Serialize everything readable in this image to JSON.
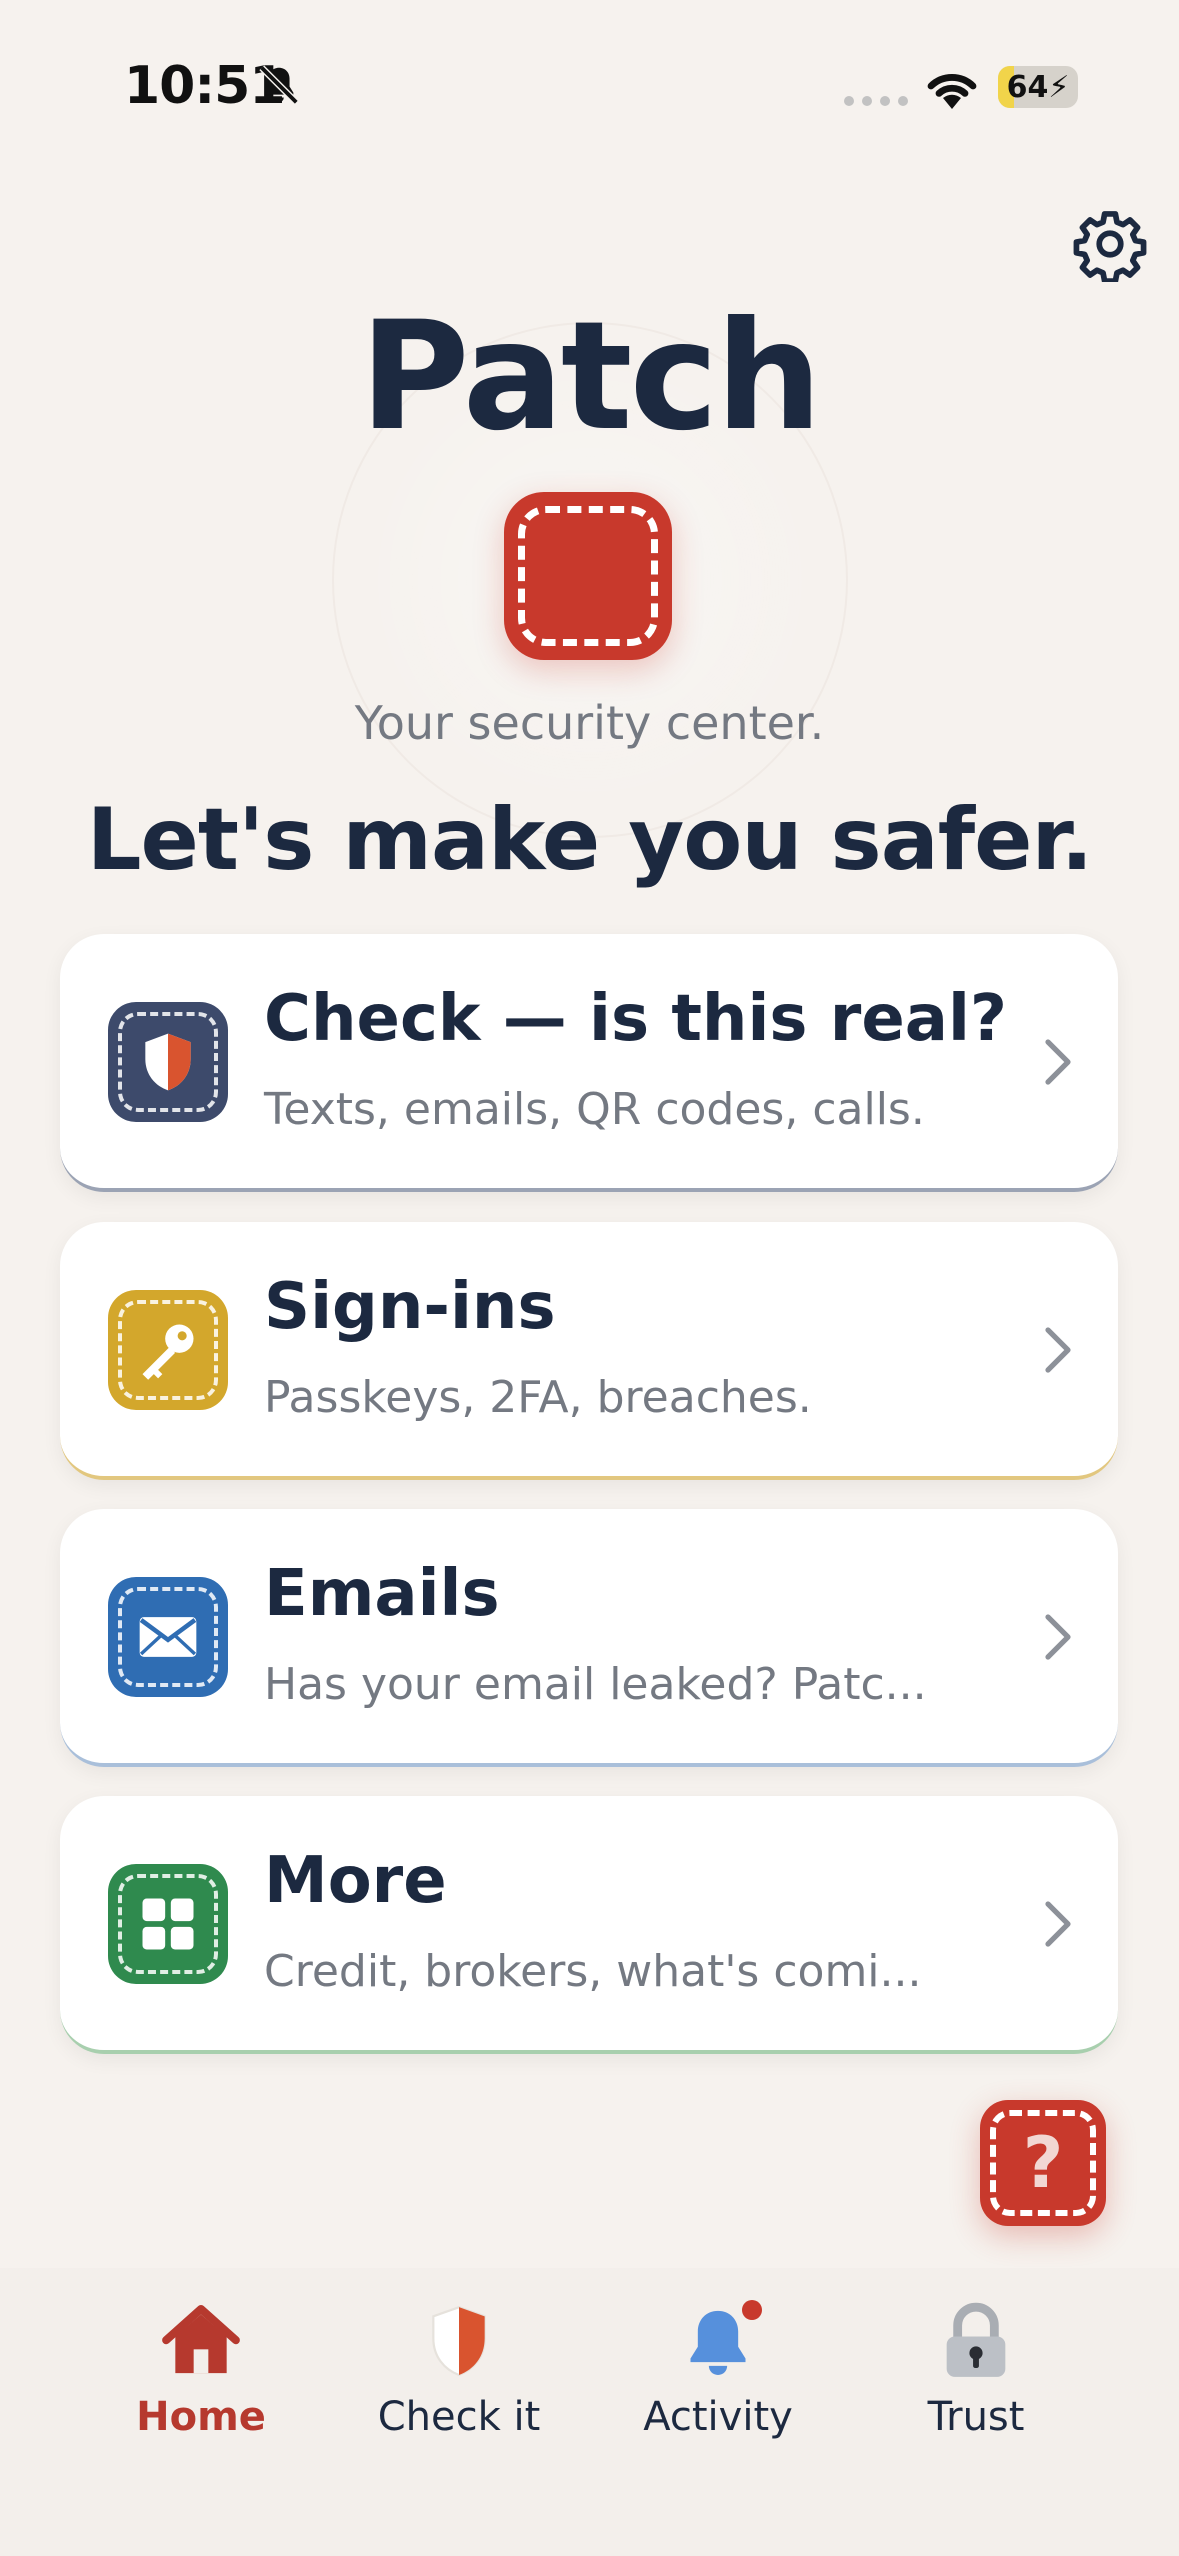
{
  "status_bar": {
    "time": "10:51",
    "battery": "64",
    "battery_level": 0.2
  },
  "header": {
    "title": "Patch",
    "subtitle": "Your security center.",
    "headline": "Let's make you safer."
  },
  "cards": [
    {
      "title": "Check — is this real?",
      "description": "Texts, emails, QR codes, calls.",
      "icon": "shield-icon",
      "color": "#3d4a6b"
    },
    {
      "title": "Sign-ins",
      "description": "Passkeys, 2FA, breaches.",
      "icon": "key-icon",
      "color": "#d3a72c"
    },
    {
      "title": "Emails",
      "description": "Has your email leaked? Patc...",
      "icon": "envelope-icon",
      "color": "#2f6db3"
    },
    {
      "title": "More",
      "description": "Credit, brokers, what's comi...",
      "icon": "grid-icon",
      "color": "#2f8a4e"
    }
  ],
  "help": {
    "mark": "?"
  },
  "tabbar": {
    "tabs": [
      {
        "label": "Home",
        "icon": "home-icon",
        "active": true
      },
      {
        "label": "Check it",
        "icon": "shield-icon",
        "active": false
      },
      {
        "label": "Activity",
        "icon": "bell-icon",
        "active": false,
        "has_badge": true
      },
      {
        "label": "Trust",
        "icon": "lock-icon",
        "active": false
      }
    ]
  },
  "colors": {
    "accent": "#c8392c",
    "background": "#f6f2ee",
    "text": "#1c2940",
    "muted": "#747982"
  }
}
